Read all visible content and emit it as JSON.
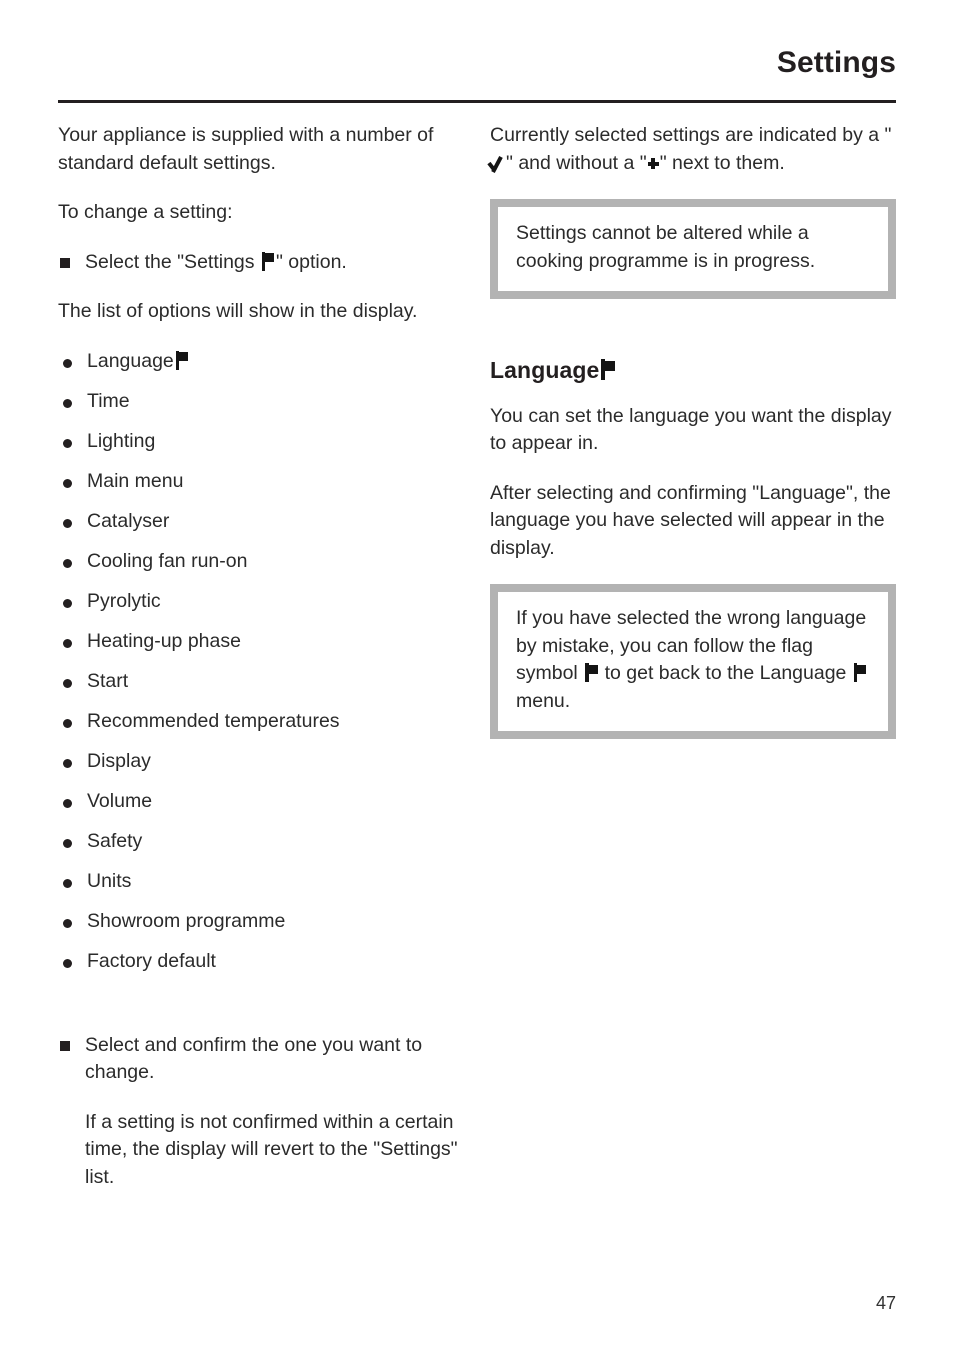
{
  "header": {
    "title": "Settings"
  },
  "left_column": {
    "intro_paragraph": "Your appliance is supplied with a number of standard default settings.",
    "to_change_label": "To change a setting:",
    "select_step_prefix": "Select the \"Settings ",
    "select_step_suffix": "\" option.",
    "list_intro": "The list of options will show in the display.",
    "options": [
      {
        "label": "Language",
        "has_flag": true
      },
      {
        "label": "Time",
        "has_flag": false
      },
      {
        "label": "Lighting",
        "has_flag": false
      },
      {
        "label": "Main menu",
        "has_flag": false
      },
      {
        "label": "Catalyser",
        "has_flag": false
      },
      {
        "label": "Cooling fan run-on",
        "has_flag": false
      },
      {
        "label": "Pyrolytic",
        "has_flag": false
      },
      {
        "label": "Heating-up phase",
        "has_flag": false
      },
      {
        "label": "Start",
        "has_flag": false
      },
      {
        "label": "Recommended temperatures",
        "has_flag": false
      },
      {
        "label": "Display",
        "has_flag": false
      },
      {
        "label": "Volume",
        "has_flag": false
      },
      {
        "label": "Safety",
        "has_flag": false
      },
      {
        "label": "Units",
        "has_flag": false
      },
      {
        "label": "Showroom programme",
        "has_flag": false
      },
      {
        "label": "Factory default",
        "has_flag": false
      }
    ],
    "confirm_step": "Select and confirm the one you want to change.",
    "revert_note": "If a setting is not confirmed within a certain time, the display will revert to the \"Settings\" list."
  },
  "right_column": {
    "selected_note_part1": "Currently selected settings are indicated by a \"",
    "selected_note_part2": "\" and without a \"",
    "selected_note_part3": "\" next to them.",
    "note_box_1": "Settings cannot be altered while a cooking programme is in progress.",
    "language_heading": "Language",
    "language_paragraph_1": "You can set the language you want the display to appear in.",
    "language_paragraph_2": "After selecting and confirming \"Language\", the language you have selected will appear in the display.",
    "note_box_2_part1": "If you have selected the wrong language by mistake, you can follow the flag symbol ",
    "note_box_2_part2": " to get  back to the Language ",
    "note_box_2_part3": " menu."
  },
  "footer": {
    "page_number": "47"
  },
  "icons": {
    "flag": "flag-icon",
    "check": "check-mark-icon",
    "cross": "cross-marker-icon",
    "square_bullet": "square-bullet-icon",
    "round_bullet": "round-bullet-icon"
  },
  "colors": {
    "text": "#2b2b2b",
    "heading": "#231f20",
    "note_border": "#b3b3b3",
    "rule": "#231f20",
    "background": "#ffffff"
  }
}
